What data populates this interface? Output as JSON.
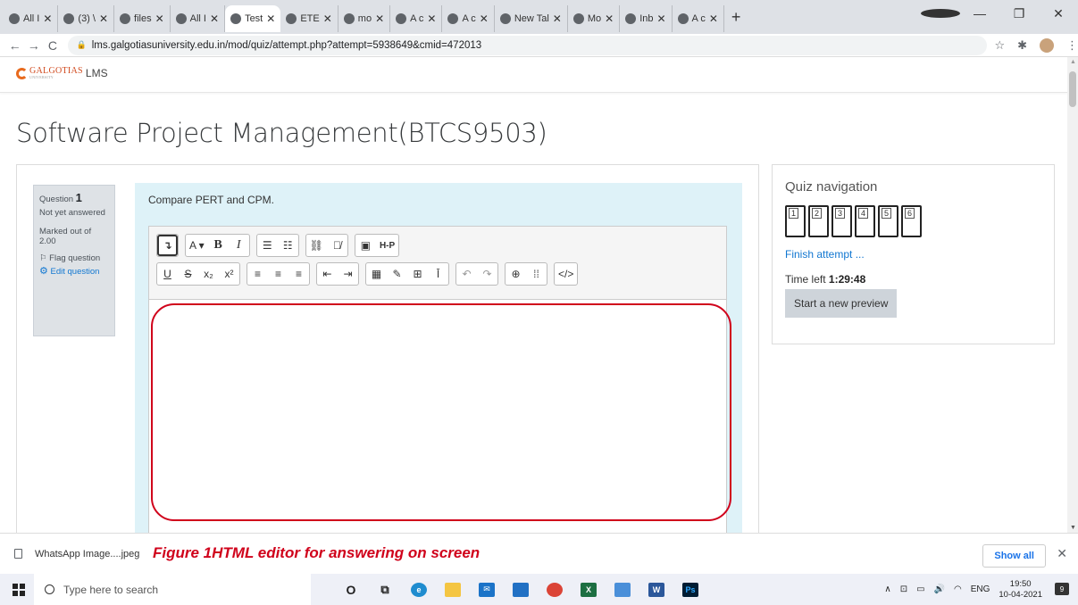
{
  "browser": {
    "tabs": [
      {
        "label": "All I",
        "active": false
      },
      {
        "label": "(3) \\",
        "active": false
      },
      {
        "label": "files",
        "active": false
      },
      {
        "label": "All I",
        "active": false
      },
      {
        "label": "Test",
        "active": true
      },
      {
        "label": "ETE",
        "active": false
      },
      {
        "label": "mo",
        "active": false
      },
      {
        "label": "A c",
        "active": false
      },
      {
        "label": "A c",
        "active": false
      },
      {
        "label": "New Tal",
        "active": false
      },
      {
        "label": "Mo",
        "active": false
      },
      {
        "label": "Inb",
        "active": false
      },
      {
        "label": "A c",
        "active": false
      }
    ],
    "url": "lms.galgotiasuniversity.edu.in/mod/quiz/attempt.php?attempt=5938649&cmid=472013"
  },
  "site": {
    "logo_text": "GALGOTIAS",
    "logo_sub": "UNIVERSITY",
    "lms_label": "LMS",
    "page_title": "Software Project Management(BTCS9503)"
  },
  "question": {
    "label": "Question",
    "number": "1",
    "status": "Not yet answered",
    "marks": "Marked out of 2.00",
    "flag": "Flag question",
    "edit": "Edit question",
    "text": "Compare PERT and CPM."
  },
  "editor": {
    "row1": [
      "↴",
      "A ▾",
      "B",
      "I",
      "☰",
      "☷",
      "⛓",
      "⛓̸",
      "▣",
      "H-P"
    ],
    "row2": [
      "U",
      "S",
      "x₂",
      "x²",
      "≡",
      "≡",
      "≡",
      "⇤",
      "⇥",
      "▦",
      "✎",
      "⊞",
      "Ī",
      "↶",
      "↷",
      "⊕",
      "⁞⁞",
      "</>"
    ]
  },
  "quiz_nav": {
    "title": "Quiz navigation",
    "questions": [
      "1",
      "2",
      "3",
      "4",
      "5",
      "6"
    ],
    "finish": "Finish attempt ...",
    "time_label": "Time left",
    "time_value": "1:29:48",
    "preview_button": "Start a new preview"
  },
  "download_bar": {
    "file": "WhatsApp Image....jpeg",
    "caption": "Figure 1HTML editor for answering on screen",
    "show_all": "Show all"
  },
  "taskbar": {
    "search_placeholder": "Type here to search",
    "lang": "ENG",
    "time": "19:50",
    "date": "10-04-2021",
    "notif_count": "9"
  }
}
